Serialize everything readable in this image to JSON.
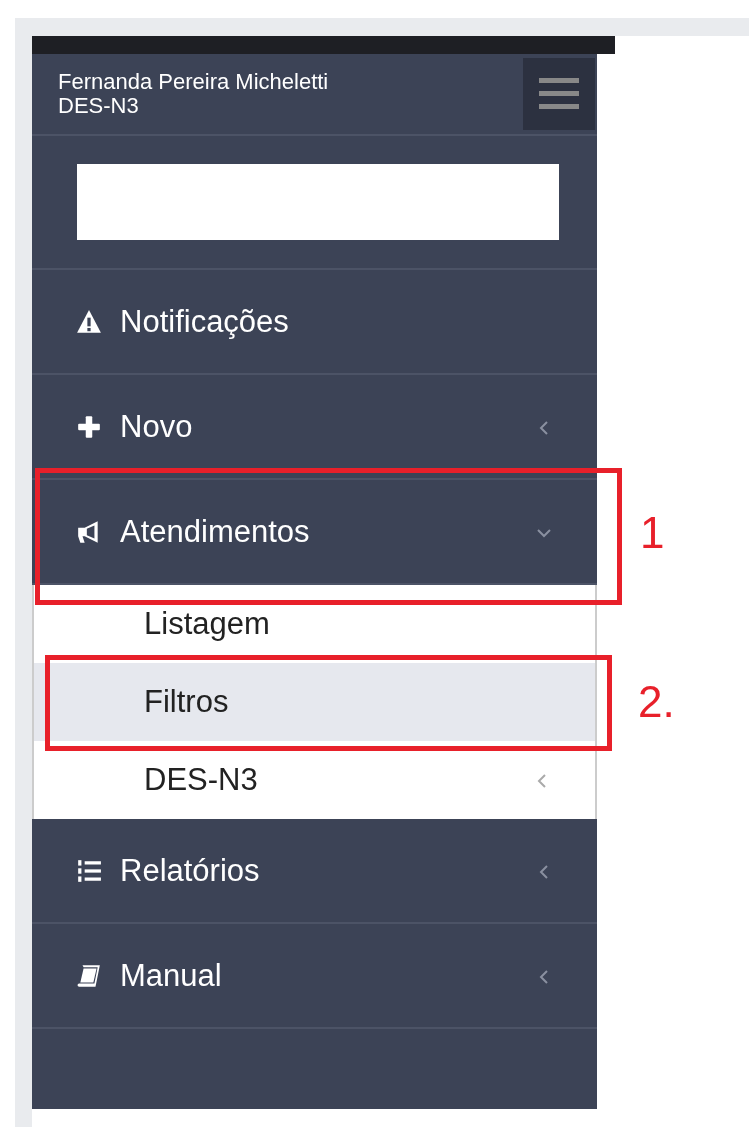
{
  "user": {
    "name": "Fernanda Pereira Micheletti",
    "role": "DES-N3"
  },
  "menu": [
    {
      "label": "Notificações",
      "kind": "plain"
    },
    {
      "label": "Novo",
      "kind": "submenu",
      "expanded": false
    },
    {
      "label": "Atendimentos",
      "kind": "submenu",
      "expanded": true,
      "annotation": "1",
      "children": [
        {
          "label": "Listagem",
          "kind": "plain",
          "selected": false
        },
        {
          "label": "Filtros",
          "kind": "plain",
          "selected": true,
          "annotation": "2."
        },
        {
          "label": "DES-N3",
          "kind": "submenu",
          "expanded": false,
          "selected": false
        }
      ]
    },
    {
      "label": "Relatórios",
      "kind": "submenu",
      "expanded": false
    },
    {
      "label": "Manual",
      "kind": "submenu",
      "expanded": false
    }
  ]
}
